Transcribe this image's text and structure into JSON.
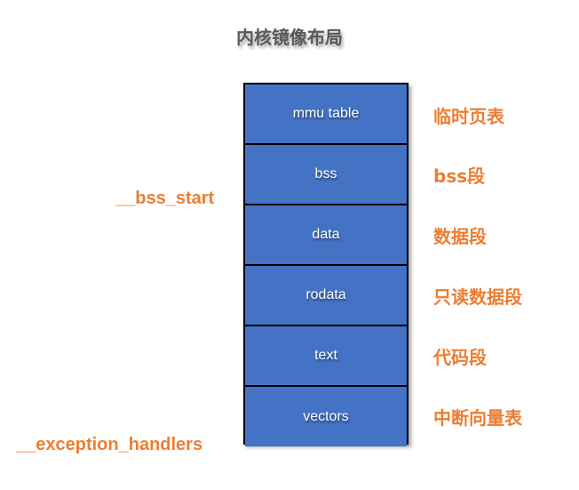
{
  "title": "内核镜像布局",
  "segments": [
    {
      "name": "mmu table",
      "desc": "临时页表"
    },
    {
      "name": "bss",
      "desc": "bss段"
    },
    {
      "name": "data",
      "desc": "数据段"
    },
    {
      "name": "rodata",
      "desc": "只读数据段"
    },
    {
      "name": "text",
      "desc": "代码段"
    },
    {
      "name": "vectors",
      "desc": "中断向量表"
    }
  ],
  "markers": {
    "bss_start": "__bss_start",
    "exception_handlers": "__exception_handlers"
  },
  "colors": {
    "segment_fill": "#4472c4",
    "label_color": "#ed7d31",
    "title_color": "#595959"
  }
}
